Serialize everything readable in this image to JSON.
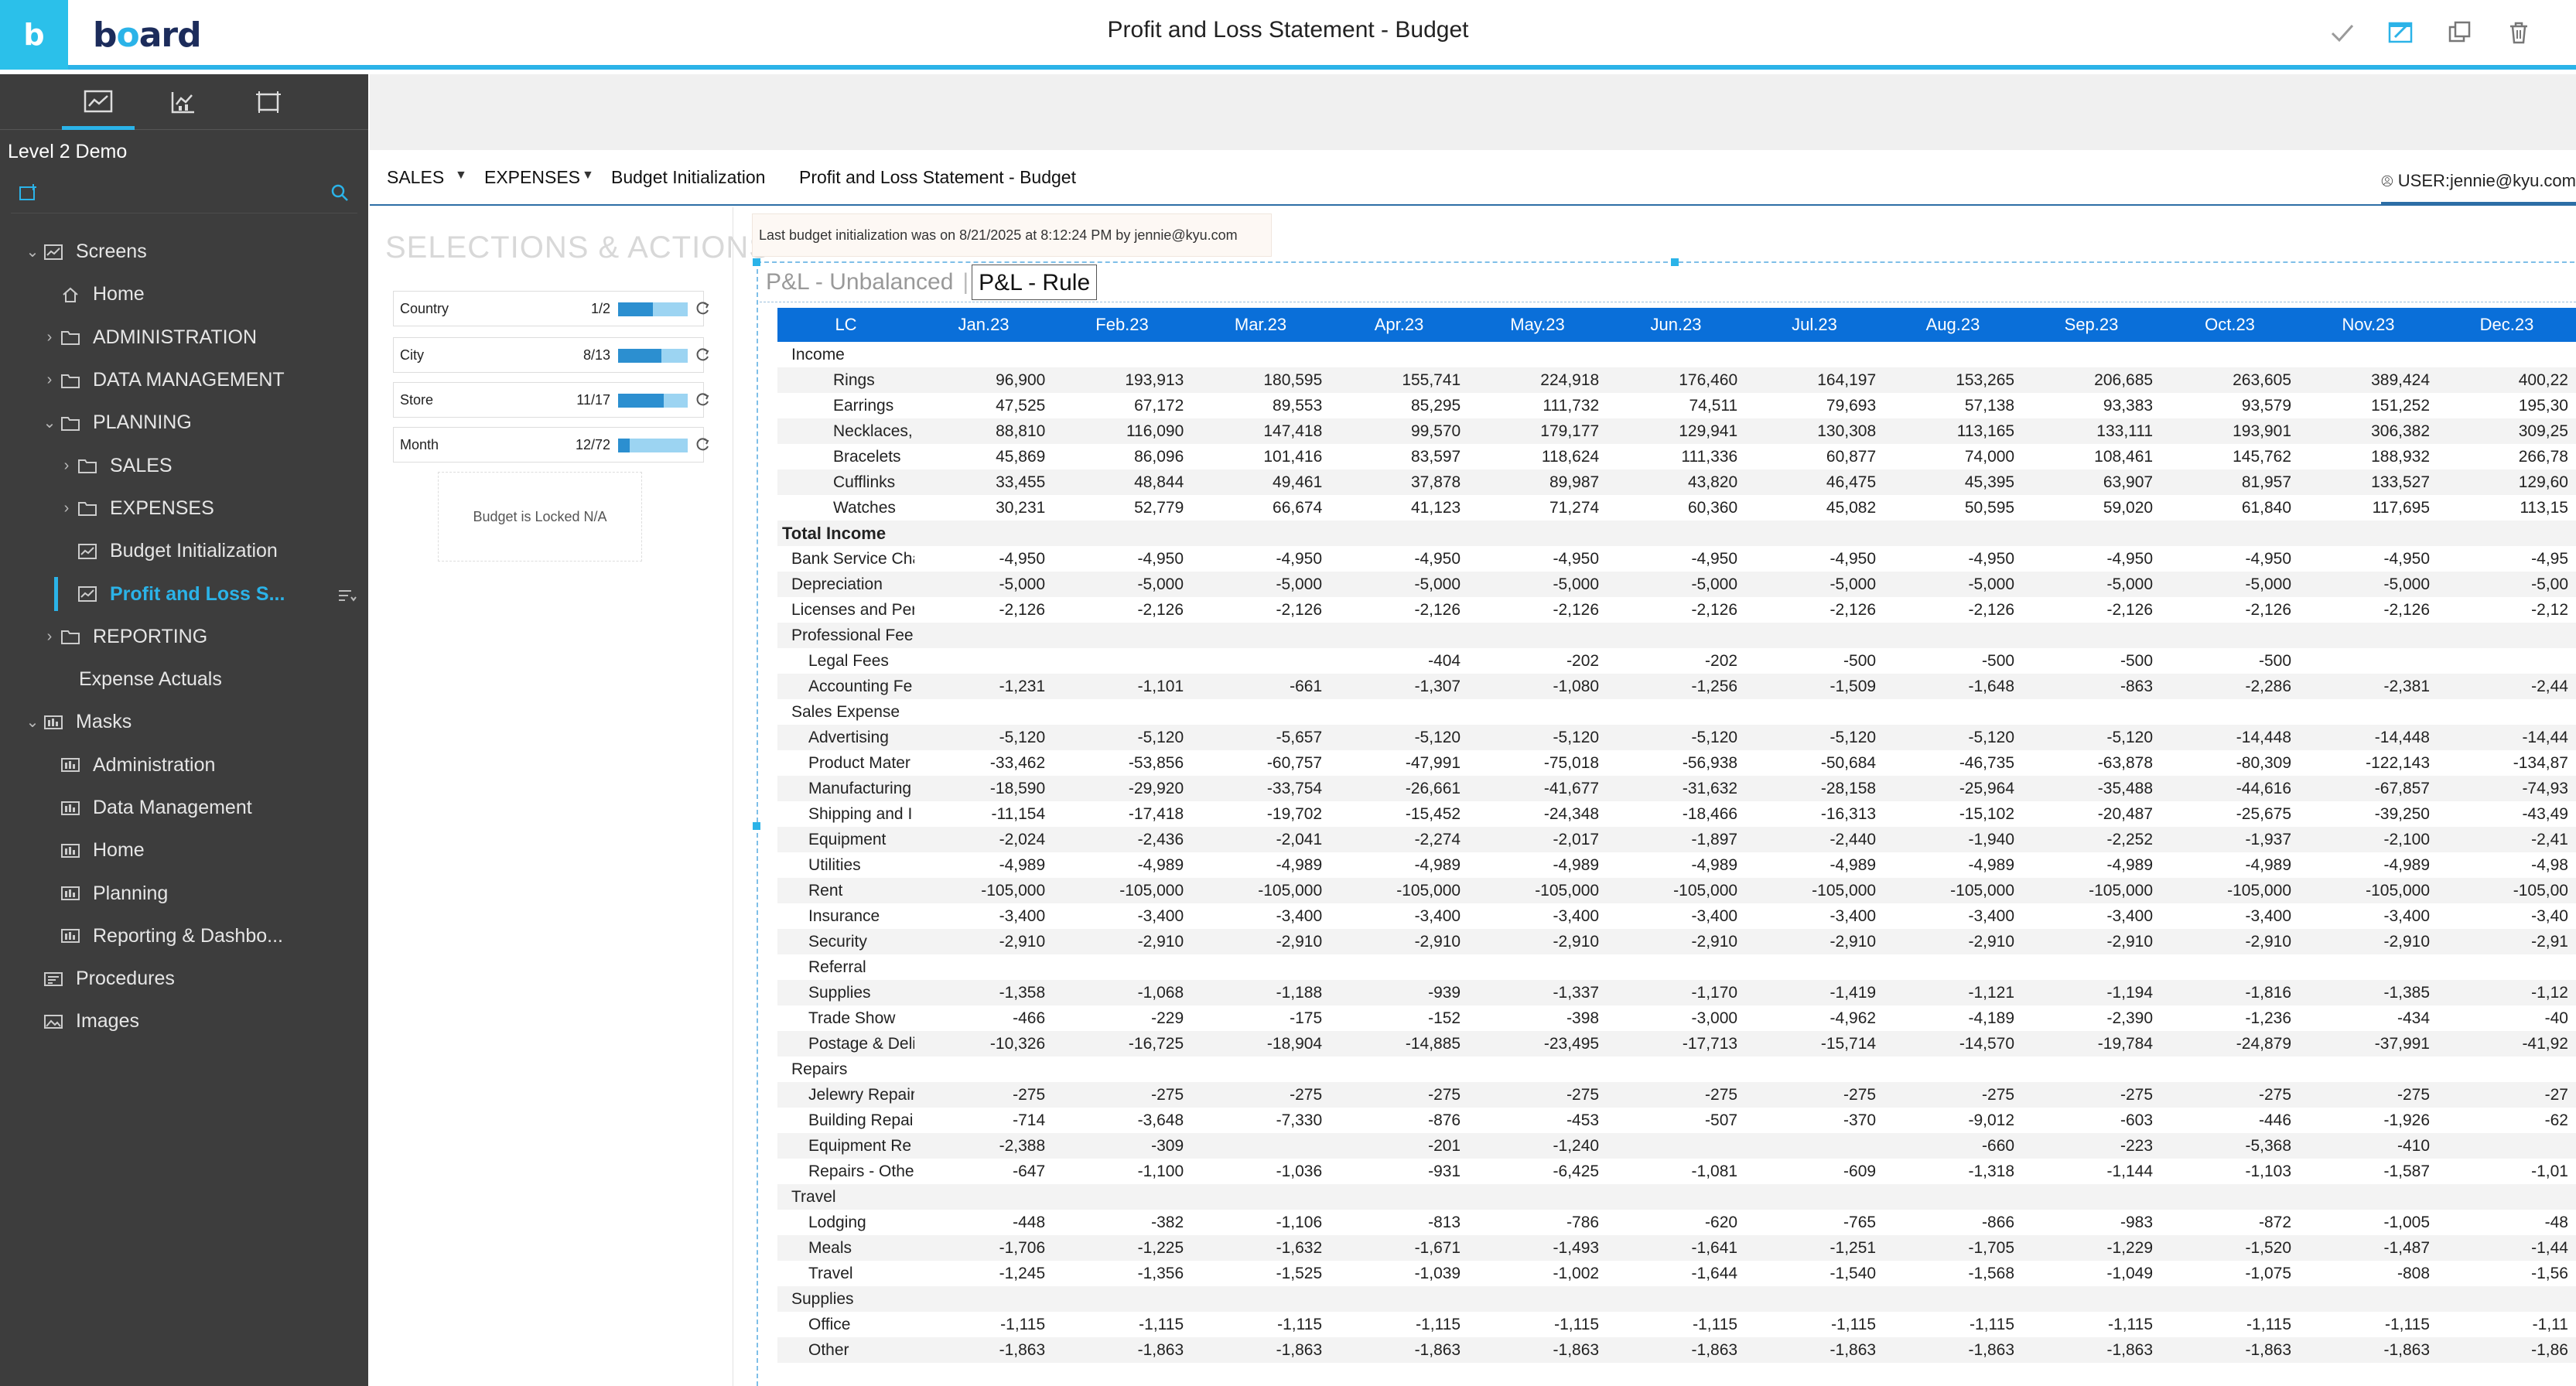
{
  "app": {
    "logo_letter": "b",
    "logo_text_1": "b",
    "logo_text_o": "o",
    "logo_text_2": "ard",
    "title": "Profit and Loss Statement - Budget"
  },
  "sidebar": {
    "project": "Level 2 Demo",
    "tree": [
      {
        "label": "Screens",
        "level": 0,
        "chevron": "⌄",
        "icon": "screen"
      },
      {
        "label": "Home",
        "level": 1,
        "chevron": "",
        "icon": "home"
      },
      {
        "label": "ADMINISTRATION",
        "level": 1,
        "chevron": "›",
        "icon": "folder"
      },
      {
        "label": "DATA MANAGEMENT",
        "level": 1,
        "chevron": "›",
        "icon": "folder"
      },
      {
        "label": "PLANNING",
        "level": 1,
        "chevron": "⌄",
        "icon": "folder"
      },
      {
        "label": "SALES",
        "level": 2,
        "chevron": "›",
        "icon": "folder"
      },
      {
        "label": "EXPENSES",
        "level": 2,
        "chevron": "›",
        "icon": "folder"
      },
      {
        "label": "Budget Initialization",
        "level": 2,
        "chevron": "",
        "icon": "screen"
      },
      {
        "label": "Profit and Loss S...",
        "level": 2,
        "chevron": "",
        "icon": "screen",
        "active": true
      },
      {
        "label": "REPORTING",
        "level": 1,
        "chevron": "›",
        "icon": "folder"
      },
      {
        "label": "Expense Actuals",
        "level": 1,
        "chevron": "",
        "icon": "none"
      },
      {
        "label": "Masks",
        "level": 0,
        "chevron": "⌄",
        "icon": "mask"
      },
      {
        "label": "Administration",
        "level": 1,
        "chevron": "",
        "icon": "mask"
      },
      {
        "label": "Data Management",
        "level": 1,
        "chevron": "",
        "icon": "mask"
      },
      {
        "label": "Home",
        "level": 1,
        "chevron": "",
        "icon": "mask"
      },
      {
        "label": "Planning",
        "level": 1,
        "chevron": "",
        "icon": "mask"
      },
      {
        "label": "Reporting & Dashbo...",
        "level": 1,
        "chevron": "",
        "icon": "mask"
      },
      {
        "label": "Procedures",
        "level": 0,
        "chevron": "",
        "icon": "procedure"
      },
      {
        "label": "Images",
        "level": 0,
        "chevron": "",
        "icon": "image"
      }
    ]
  },
  "navbar": {
    "sales": "SALES",
    "expenses": "EXPENSES",
    "budget_init": "Budget Initialization",
    "pl": "Profit and Loss Statement - Budget",
    "user": "USER:jennie@kyu.com"
  },
  "selections": {
    "title": "SELECTIONS & ACTIONS",
    "rows": [
      {
        "label": "Country",
        "count": "1/2",
        "fill": 0.5
      },
      {
        "label": "City",
        "count": "8/13",
        "fill": 0.62
      },
      {
        "label": "Store",
        "count": "11/17",
        "fill": 0.65
      },
      {
        "label": "Month",
        "count": "12/72",
        "fill": 0.17
      }
    ],
    "locked": "Budget is Locked N/A"
  },
  "note": "Last budget initialization was on 8/21/2025 at 8:12:24 PM by jennie@kyu.com",
  "tabs": {
    "unbalanced": "P&L - Unbalanced",
    "sep": "|",
    "rule": "P&L - Rule"
  },
  "table": {
    "header_first": "LC",
    "months": [
      "Jan.23",
      "Feb.23",
      "Mar.23",
      "Apr.23",
      "May.23",
      "Jun.23",
      "Jul.23",
      "Aug.23",
      "Sep.23",
      "Oct.23",
      "Nov.23",
      "Dec.23"
    ],
    "rows": [
      {
        "label": "Income",
        "indent": "ind0",
        "values": []
      },
      {
        "label": "Rings",
        "indent": "ind2",
        "values": [
          "96,900",
          "193,913",
          "180,595",
          "155,741",
          "224,918",
          "176,460",
          "164,197",
          "153,265",
          "206,685",
          "263,605",
          "389,424",
          "400,22"
        ]
      },
      {
        "label": "Earrings",
        "indent": "ind2",
        "values": [
          "47,525",
          "67,172",
          "89,553",
          "85,295",
          "111,732",
          "74,511",
          "79,693",
          "57,138",
          "93,383",
          "93,579",
          "151,252",
          "195,30"
        ]
      },
      {
        "label": "Necklaces,",
        "indent": "ind2",
        "values": [
          "88,810",
          "116,090",
          "147,418",
          "99,570",
          "179,177",
          "129,941",
          "130,308",
          "113,165",
          "133,111",
          "193,901",
          "306,382",
          "309,25"
        ]
      },
      {
        "label": "Bracelets",
        "indent": "ind2",
        "values": [
          "45,869",
          "86,096",
          "101,416",
          "83,597",
          "118,624",
          "111,336",
          "60,877",
          "74,000",
          "108,461",
          "145,762",
          "188,932",
          "266,78"
        ]
      },
      {
        "label": "Cufflinks",
        "indent": "ind2",
        "values": [
          "33,455",
          "48,844",
          "49,461",
          "37,878",
          "89,987",
          "43,820",
          "46,475",
          "45,395",
          "63,907",
          "81,957",
          "133,527",
          "129,60"
        ]
      },
      {
        "label": "Watches",
        "indent": "ind2",
        "values": [
          "30,231",
          "52,779",
          "66,674",
          "41,123",
          "71,274",
          "60,360",
          "45,082",
          "50,595",
          "59,020",
          "61,840",
          "117,695",
          "113,15"
        ]
      },
      {
        "label": "Total Income",
        "indent": "tot",
        "bold": true,
        "values": []
      },
      {
        "label": "Bank Service Cha",
        "indent": "ind0",
        "values": [
          "-4,950",
          "-4,950",
          "-4,950",
          "-4,950",
          "-4,950",
          "-4,950",
          "-4,950",
          "-4,950",
          "-4,950",
          "-4,950",
          "-4,950",
          "-4,95"
        ]
      },
      {
        "label": "Depreciation",
        "indent": "ind0",
        "values": [
          "-5,000",
          "-5,000",
          "-5,000",
          "-5,000",
          "-5,000",
          "-5,000",
          "-5,000",
          "-5,000",
          "-5,000",
          "-5,000",
          "-5,000",
          "-5,00"
        ]
      },
      {
        "label": "Licenses and Per",
        "indent": "ind0",
        "values": [
          "-2,126",
          "-2,126",
          "-2,126",
          "-2,126",
          "-2,126",
          "-2,126",
          "-2,126",
          "-2,126",
          "-2,126",
          "-2,126",
          "-2,126",
          "-2,12"
        ]
      },
      {
        "label": "Professional Fee",
        "indent": "ind0",
        "values": []
      },
      {
        "label": "Legal Fees",
        "indent": "ind1",
        "values": [
          "",
          "",
          "",
          "-404",
          "-202",
          "-202",
          "-500",
          "-500",
          "-500",
          "-500",
          "",
          ""
        ]
      },
      {
        "label": "Accounting Fe",
        "indent": "ind1",
        "values": [
          "-1,231",
          "-1,101",
          "-661",
          "-1,307",
          "-1,080",
          "-1,256",
          "-1,509",
          "-1,648",
          "-863",
          "-2,286",
          "-2,381",
          "-2,44"
        ]
      },
      {
        "label": "Sales Expense",
        "indent": "ind0",
        "values": []
      },
      {
        "label": "Advertising",
        "indent": "ind1",
        "values": [
          "-5,120",
          "-5,120",
          "-5,657",
          "-5,120",
          "-5,120",
          "-5,120",
          "-5,120",
          "-5,120",
          "-5,120",
          "-14,448",
          "-14,448",
          "-14,44"
        ]
      },
      {
        "label": "Product Mater",
        "indent": "ind1",
        "values": [
          "-33,462",
          "-53,856",
          "-60,757",
          "-47,991",
          "-75,018",
          "-56,938",
          "-50,684",
          "-46,735",
          "-63,878",
          "-80,309",
          "-122,143",
          "-134,87"
        ]
      },
      {
        "label": "Manufacturing",
        "indent": "ind1",
        "values": [
          "-18,590",
          "-29,920",
          "-33,754",
          "-26,661",
          "-41,677",
          "-31,632",
          "-28,158",
          "-25,964",
          "-35,488",
          "-44,616",
          "-67,857",
          "-74,93"
        ]
      },
      {
        "label": "Shipping and I",
        "indent": "ind1",
        "values": [
          "-11,154",
          "-17,418",
          "-19,702",
          "-15,452",
          "-24,348",
          "-18,466",
          "-16,313",
          "-15,102",
          "-20,487",
          "-25,675",
          "-39,250",
          "-43,49"
        ]
      },
      {
        "label": "Equipment",
        "indent": "ind1",
        "values": [
          "-2,024",
          "-2,436",
          "-2,041",
          "-2,274",
          "-2,017",
          "-1,897",
          "-2,440",
          "-1,940",
          "-2,252",
          "-1,937",
          "-2,100",
          "-2,41"
        ]
      },
      {
        "label": "Utilities",
        "indent": "ind1",
        "values": [
          "-4,989",
          "-4,989",
          "-4,989",
          "-4,989",
          "-4,989",
          "-4,989",
          "-4,989",
          "-4,989",
          "-4,989",
          "-4,989",
          "-4,989",
          "-4,98"
        ]
      },
      {
        "label": "Rent",
        "indent": "ind1",
        "values": [
          "-105,000",
          "-105,000",
          "-105,000",
          "-105,000",
          "-105,000",
          "-105,000",
          "-105,000",
          "-105,000",
          "-105,000",
          "-105,000",
          "-105,000",
          "-105,00"
        ]
      },
      {
        "label": "Insurance",
        "indent": "ind1",
        "values": [
          "-3,400",
          "-3,400",
          "-3,400",
          "-3,400",
          "-3,400",
          "-3,400",
          "-3,400",
          "-3,400",
          "-3,400",
          "-3,400",
          "-3,400",
          "-3,40"
        ]
      },
      {
        "label": "Security",
        "indent": "ind1",
        "values": [
          "-2,910",
          "-2,910",
          "-2,910",
          "-2,910",
          "-2,910",
          "-2,910",
          "-2,910",
          "-2,910",
          "-2,910",
          "-2,910",
          "-2,910",
          "-2,91"
        ]
      },
      {
        "label": "Referral",
        "indent": "ind1",
        "values": []
      },
      {
        "label": "Supplies",
        "indent": "ind1",
        "values": [
          "-1,358",
          "-1,068",
          "-1,188",
          "-939",
          "-1,337",
          "-1,170",
          "-1,419",
          "-1,121",
          "-1,194",
          "-1,816",
          "-1,385",
          "-1,12"
        ]
      },
      {
        "label": "Trade Show",
        "indent": "ind1",
        "values": [
          "-466",
          "-229",
          "-175",
          "-152",
          "-398",
          "-3,000",
          "-4,962",
          "-4,189",
          "-2,390",
          "-1,236",
          "-434",
          "-40"
        ]
      },
      {
        "label": "Postage & Deli",
        "indent": "ind1",
        "values": [
          "-10,326",
          "-16,725",
          "-18,904",
          "-14,885",
          "-23,495",
          "-17,713",
          "-15,714",
          "-14,570",
          "-19,784",
          "-24,879",
          "-37,991",
          "-41,92"
        ]
      },
      {
        "label": "Repairs",
        "indent": "ind0",
        "values": []
      },
      {
        "label": "Jelewry Repair",
        "indent": "ind1",
        "values": [
          "-275",
          "-275",
          "-275",
          "-275",
          "-275",
          "-275",
          "-275",
          "-275",
          "-275",
          "-275",
          "-275",
          "-27"
        ]
      },
      {
        "label": "Building Repai",
        "indent": "ind1",
        "values": [
          "-714",
          "-3,648",
          "-7,330",
          "-876",
          "-453",
          "-507",
          "-370",
          "-9,012",
          "-603",
          "-446",
          "-1,926",
          "-62"
        ]
      },
      {
        "label": "Equipment Re",
        "indent": "ind1",
        "values": [
          "-2,388",
          "-309",
          "",
          "-201",
          "-1,240",
          "",
          "",
          "-660",
          "-223",
          "-5,368",
          "-410",
          ""
        ]
      },
      {
        "label": "Repairs - Othe",
        "indent": "ind1",
        "values": [
          "-647",
          "-1,100",
          "-1,036",
          "-931",
          "-6,425",
          "-1,081",
          "-609",
          "-1,318",
          "-1,144",
          "-1,103",
          "-1,587",
          "-1,01"
        ]
      },
      {
        "label": "Travel",
        "indent": "ind0",
        "values": []
      },
      {
        "label": "Lodging",
        "indent": "ind1",
        "values": [
          "-448",
          "-382",
          "-1,106",
          "-813",
          "-786",
          "-620",
          "-765",
          "-866",
          "-983",
          "-872",
          "-1,005",
          "-48"
        ]
      },
      {
        "label": "Meals",
        "indent": "ind1",
        "values": [
          "-1,706",
          "-1,225",
          "-1,632",
          "-1,671",
          "-1,493",
          "-1,641",
          "-1,251",
          "-1,705",
          "-1,229",
          "-1,520",
          "-1,487",
          "-1,44"
        ]
      },
      {
        "label": "Travel",
        "indent": "ind1",
        "values": [
          "-1,245",
          "-1,356",
          "-1,525",
          "-1,039",
          "-1,002",
          "-1,644",
          "-1,540",
          "-1,568",
          "-1,049",
          "-1,075",
          "-808",
          "-1,56"
        ]
      },
      {
        "label": "Supplies",
        "indent": "ind0",
        "values": []
      },
      {
        "label": "Office",
        "indent": "ind1",
        "values": [
          "-1,115",
          "-1,115",
          "-1,115",
          "-1,115",
          "-1,115",
          "-1,115",
          "-1,115",
          "-1,115",
          "-1,115",
          "-1,115",
          "-1,115",
          "-1,11"
        ]
      },
      {
        "label": "Other",
        "indent": "ind1",
        "values": [
          "-1,863",
          "-1,863",
          "-1,863",
          "-1,863",
          "-1,863",
          "-1,863",
          "-1,863",
          "-1,863",
          "-1,863",
          "-1,863",
          "-1,863",
          "-1,86"
        ]
      }
    ]
  },
  "colors": {
    "accent": "#2bb3e8",
    "header_blue": "#0a6fd9",
    "sidebar_bg": "#3d3d3d"
  }
}
